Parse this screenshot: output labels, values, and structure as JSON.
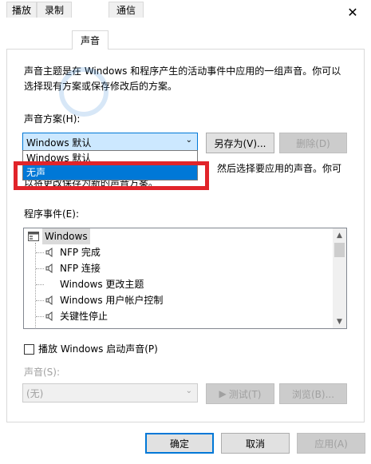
{
  "window": {
    "title": "声音"
  },
  "tabs": [
    {
      "label": "播放"
    },
    {
      "label": "录制"
    },
    {
      "label": "声音"
    },
    {
      "label": "通信"
    }
  ],
  "description": {
    "line1": "声音主题是在 Windows 和程序产生的活动事件中应用的一组声音。你可以",
    "line2": "选择现有方案或保存修改后的方案。"
  },
  "scheme": {
    "label": "声音方案(H):",
    "selected": "Windows 默认",
    "save_as": "另存为(V)...",
    "delete": "删除(D)"
  },
  "dropdown": {
    "options": [
      "Windows 默认",
      "无声"
    ]
  },
  "behind_text": {
    "line1": "然后选择要应用的声音。你可",
    "line2": "以将更改保存为新的声音方案。"
  },
  "events": {
    "label": "程序事件(E):",
    "items": [
      {
        "label": "Windows"
      },
      {
        "label": "NFP 完成"
      },
      {
        "label": "NFP 连接"
      },
      {
        "label": "Windows 更改主题"
      },
      {
        "label": "Windows 用户帐户控制"
      },
      {
        "label": "关键性停止"
      }
    ]
  },
  "startup_sound": {
    "label": "播放 Windows 启动声音(P)",
    "checked": false
  },
  "sound": {
    "label": "声音(S):",
    "selected": "(无)",
    "test": "测试(T)",
    "browse": "浏览(B)..."
  },
  "footer": {
    "ok": "确定",
    "cancel": "取消",
    "apply": "应用(A)"
  },
  "colors": {
    "accent": "#0078d7",
    "highlight_box": "#e1242a"
  }
}
